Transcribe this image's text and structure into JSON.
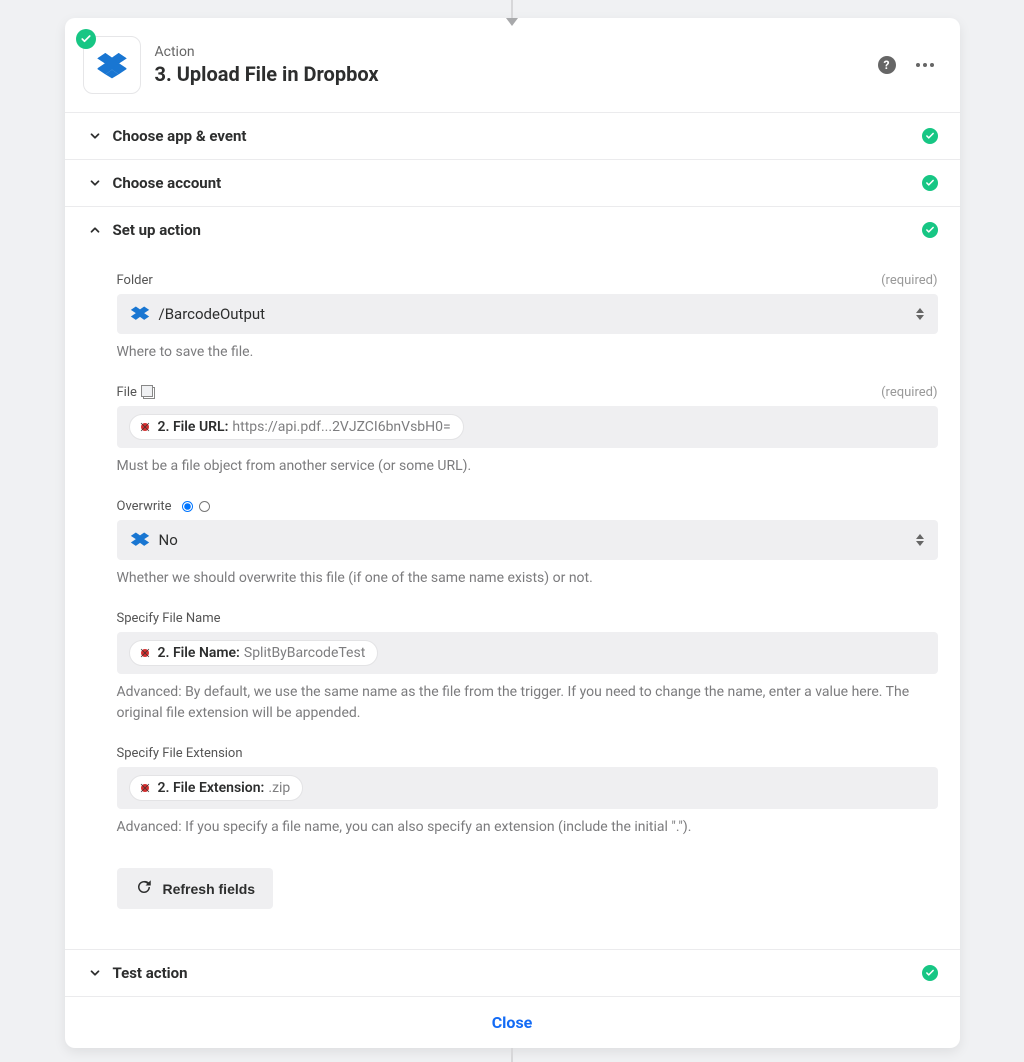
{
  "header": {
    "label": "Action",
    "title": "3. Upload File in Dropbox"
  },
  "sections": {
    "choose_app": "Choose app & event",
    "choose_account": "Choose account",
    "setup_action": "Set up action",
    "test_action": "Test action"
  },
  "fields": {
    "folder": {
      "label": "Folder",
      "required": "(required)",
      "value": "/BarcodeOutput",
      "help": "Where to save the file."
    },
    "file": {
      "label": "File",
      "required": "(required)",
      "pill_label": "2. File URL:",
      "pill_value": "https://api.pdf...2VJZCI6bnVsbH0=",
      "help": "Must be a file object from another service (or some URL)."
    },
    "overwrite": {
      "label": "Overwrite",
      "value": "No",
      "help": "Whether we should overwrite this file (if one of the same name exists) or not."
    },
    "file_name": {
      "label": "Specify File Name",
      "pill_label": "2. File Name:",
      "pill_value": "SplitByBarcodeTest",
      "help": "Advanced: By default, we use the same name as the file from the trigger. If you need to change the name, enter a value here. The original file extension will be appended."
    },
    "file_ext": {
      "label": "Specify File Extension",
      "pill_label": "2. File Extension:",
      "pill_value": ".zip",
      "help": "Advanced: If you specify a file name, you can also specify an extension (include the initial \".\")."
    }
  },
  "buttons": {
    "refresh": "Refresh fields",
    "close": "Close"
  }
}
